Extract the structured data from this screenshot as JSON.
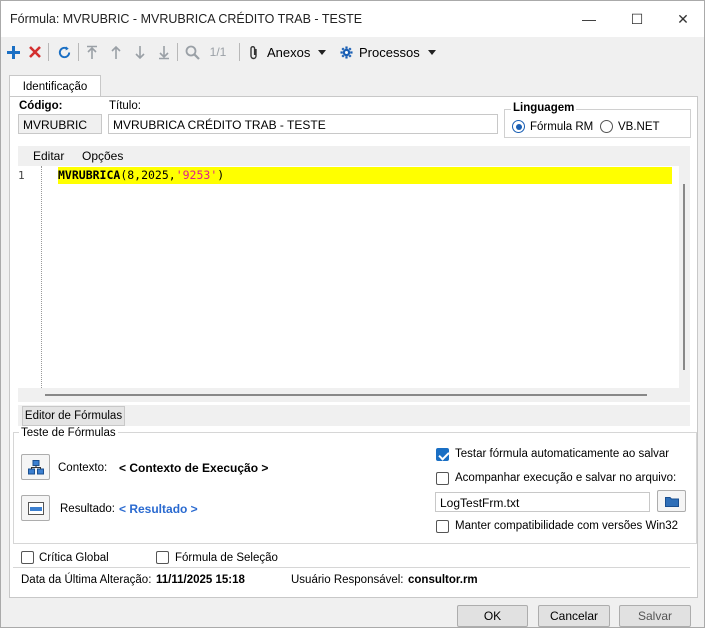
{
  "window": {
    "title": "Fórmula: MVRUBRIC - MVRUBRICA CRÉDITO TRAB - TESTE",
    "minimize_glyph": "—",
    "maximize_glyph": "☐",
    "close_glyph": "✕"
  },
  "toolbar": {
    "page_counter": "1/1",
    "anexos_label": "Anexos",
    "processos_label": "Processos",
    "colors": {
      "add": "#1a6fc4",
      "delete": "#d32f2f",
      "refresh": "#1a6fc4",
      "disabled": "#9aa0a6"
    }
  },
  "tabs": [
    {
      "label": "Identificação",
      "active": true
    }
  ],
  "form": {
    "codigo_label": "Código:",
    "codigo_value": "MVRUBRIC",
    "titulo_label": "Título:",
    "titulo_value": "MVRUBRICA CRÉDITO TRAB - TESTE",
    "linguagem": {
      "label": "Linguagem",
      "options": [
        {
          "label": "Fórmula RM",
          "selected": true
        },
        {
          "label": "VB.NET",
          "selected": false
        }
      ]
    }
  },
  "editor": {
    "menu": [
      "Editar",
      "Opções"
    ],
    "line_number": "1",
    "code_fn": "MVRUBRICA",
    "code_args": "(8,2025,",
    "code_string": "'9253'",
    "code_close": ")",
    "highlight_color": "#ffff00",
    "string_color": "#e0218a",
    "sub_tab": "Editor de Fórmulas"
  },
  "teste": {
    "group_label": "Teste de Fórmulas",
    "contexto_label": "Contexto:",
    "contexto_value": "< Contexto de Execução >",
    "resultado_label": "Resultado:",
    "resultado_value": "< Resultado >",
    "resultado_color": "#2a6ad0",
    "testar_auto": {
      "label": "Testar fórmula automaticamente ao salvar",
      "checked": true
    },
    "acompanhar": {
      "label": "Acompanhar execução e salvar no arquivo:",
      "checked": false
    },
    "arquivo_value": "LogTestFrm.txt",
    "compat": {
      "label": "Manter compatibilidade com versões Win32",
      "checked": false
    }
  },
  "footer": {
    "critica_global": {
      "label": "Crítica Global",
      "checked": false
    },
    "formula_selecao": {
      "label": "Fórmula de Seleção",
      "checked": false
    },
    "data_label": "Data da Última Alteração:",
    "data_value": "11/11/2025 15:18",
    "usuario_label": "Usuário Responsável:",
    "usuario_value": "consultor.rm"
  },
  "buttons": {
    "ok": "OK",
    "cancelar": "Cancelar",
    "salvar": "Salvar"
  }
}
